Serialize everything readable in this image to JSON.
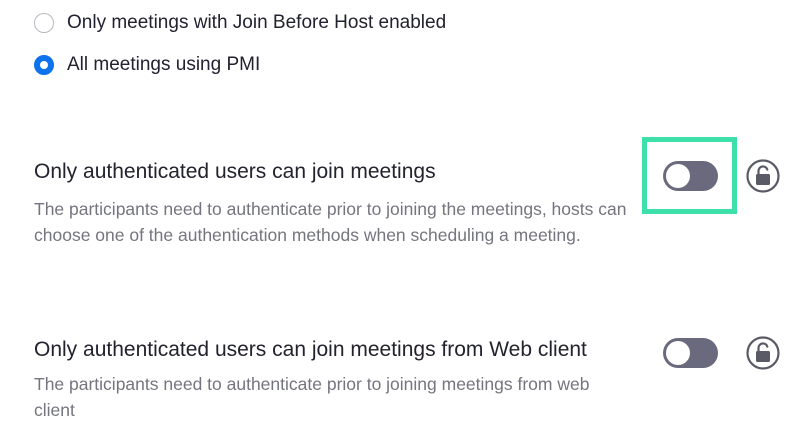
{
  "radio_options": [
    {
      "label": "Only meetings with Join Before Host enabled",
      "selected": false
    },
    {
      "label": "All meetings using PMI",
      "selected": true
    }
  ],
  "settings": [
    {
      "title": "Only authenticated users can join meetings",
      "description": "The participants need to authenticate prior to joining the meetings, hosts can choose one of the authentication methods when scheduling a meeting.",
      "enabled": false,
      "highlighted": true
    },
    {
      "title": "Only authenticated users can join meetings from Web client",
      "description": "The participants need to authenticate prior to joining meetings from web client",
      "enabled": false,
      "highlighted": false
    }
  ],
  "colors": {
    "accent": "#0e72ed",
    "toggle_off": "#6a6a7e",
    "highlight_box": "#3de0a8",
    "description_text": "#75757f"
  },
  "icons": {
    "lock": "unlock-icon"
  }
}
